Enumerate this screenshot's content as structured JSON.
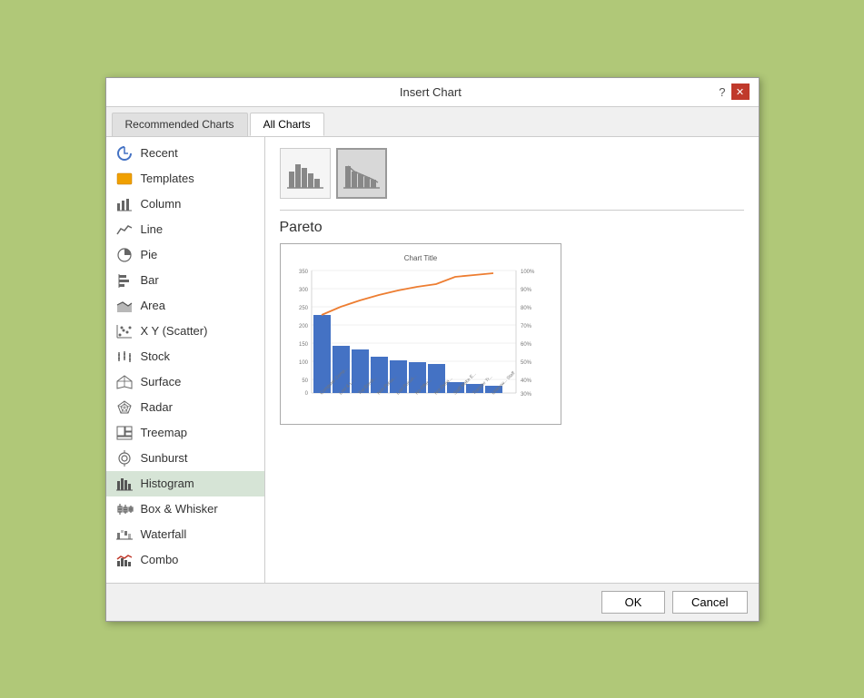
{
  "dialog": {
    "title": "Insert Chart"
  },
  "tabs": {
    "recommended": "Recommended Charts",
    "all": "All Charts",
    "active": "all"
  },
  "sidebar": {
    "items": [
      {
        "id": "recent",
        "label": "Recent"
      },
      {
        "id": "templates",
        "label": "Templates"
      },
      {
        "id": "column",
        "label": "Column"
      },
      {
        "id": "line",
        "label": "Line"
      },
      {
        "id": "pie",
        "label": "Pie"
      },
      {
        "id": "bar",
        "label": "Bar"
      },
      {
        "id": "area",
        "label": "Area"
      },
      {
        "id": "xy-scatter",
        "label": "X Y (Scatter)"
      },
      {
        "id": "stock",
        "label": "Stock"
      },
      {
        "id": "surface",
        "label": "Surface"
      },
      {
        "id": "radar",
        "label": "Radar"
      },
      {
        "id": "treemap",
        "label": "Treemap"
      },
      {
        "id": "sunburst",
        "label": "Sunburst"
      },
      {
        "id": "histogram",
        "label": "Histogram",
        "selected": true
      },
      {
        "id": "box-whisker",
        "label": "Box & Whisker"
      },
      {
        "id": "waterfall",
        "label": "Waterfall"
      },
      {
        "id": "combo",
        "label": "Combo"
      }
    ]
  },
  "main": {
    "chart_name": "Pareto",
    "chart_title_label": "Chart Title"
  },
  "footer": {
    "ok_label": "OK",
    "cancel_label": "Cancel"
  },
  "title_bar": {
    "help_symbol": "?",
    "close_symbol": "✕"
  }
}
